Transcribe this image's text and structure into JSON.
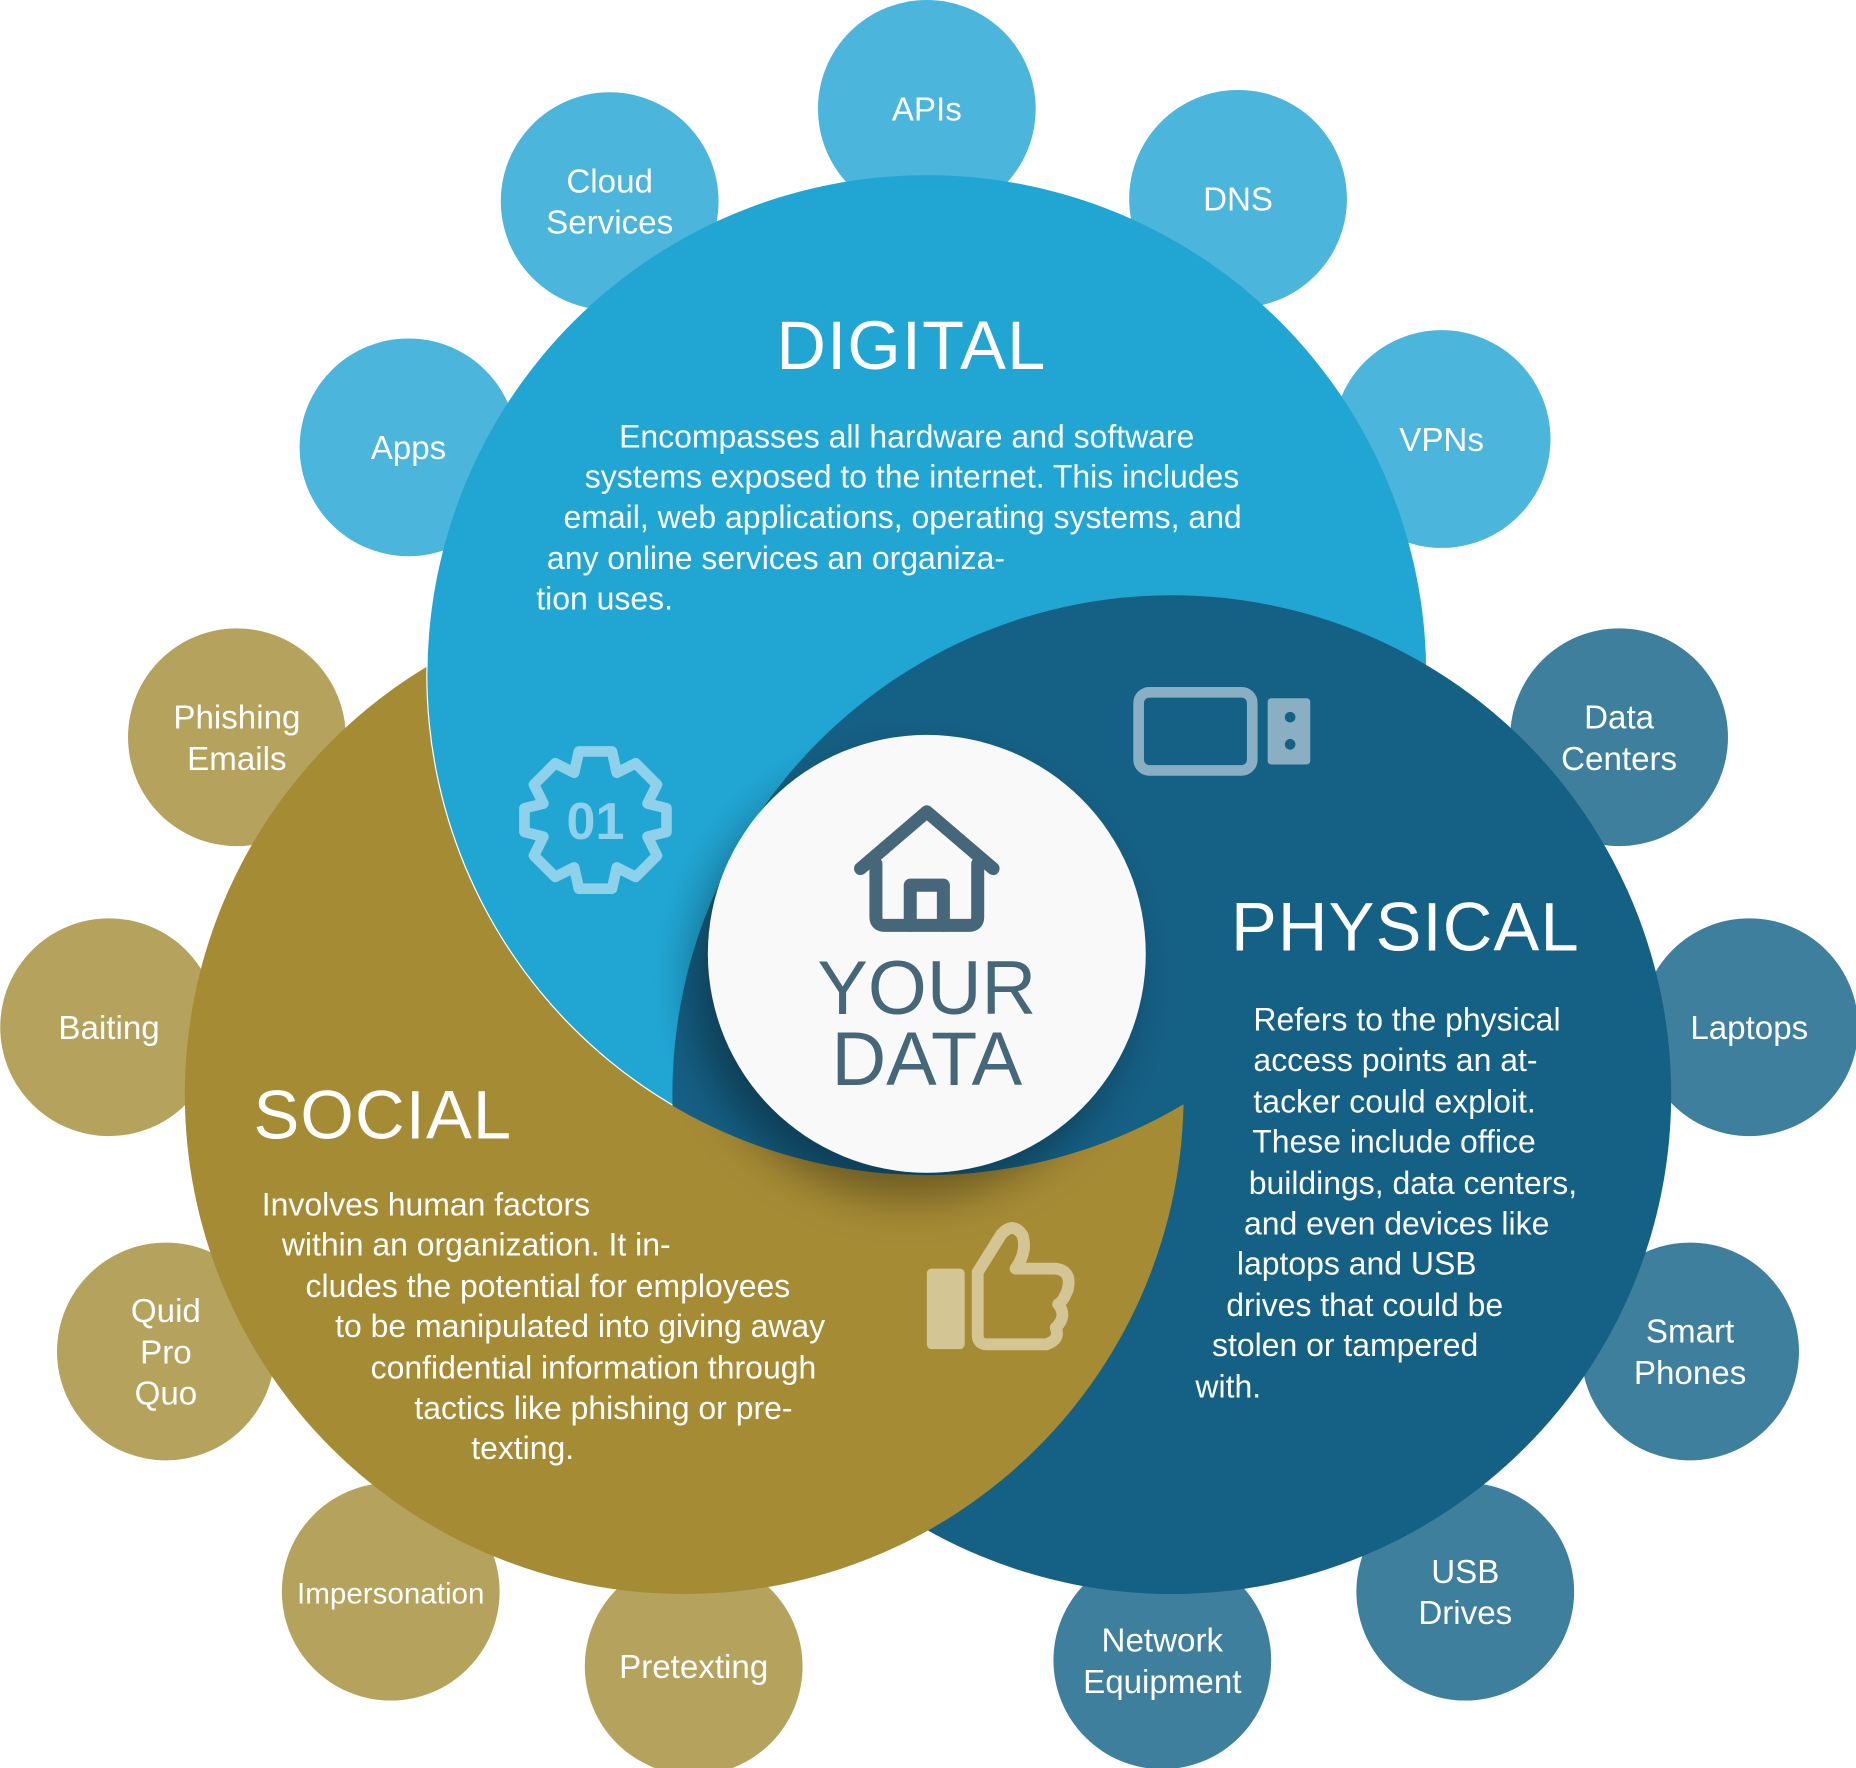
{
  "colors": {
    "digital": "#21a6d4",
    "digital_small": "#4bb5dc",
    "physical": "#156085",
    "physical_small": "#3f7f9e",
    "social": "#a68b35",
    "social_small": "#b5a25c",
    "center_text": "#46677a"
  },
  "center": {
    "line1": "YOUR",
    "line2": "DATA",
    "icon": "house-icon"
  },
  "digital": {
    "title": "DIGITAL",
    "icon": "gear-01-icon",
    "icon_text": "01",
    "lines": [
      "Encompasses all hardware and software",
      "systems exposed to the internet. This includes",
      "email, web applications, operating systems, and",
      "any online services an organiza-",
      "tion uses."
    ],
    "items": [
      [
        "APIs"
      ],
      [
        "DNS"
      ],
      [
        "VPNs"
      ],
      [
        "Cloud",
        "Services"
      ],
      [
        "Apps"
      ]
    ]
  },
  "physical": {
    "title": "PHYSICAL",
    "icon": "tablet-usb-icon",
    "lines": [
      "Refers to the physical",
      "access points an at-",
      "tacker could exploit.",
      "These include office",
      "buildings, data centers,",
      "and even devices like",
      "laptops and USB",
      "drives that could be",
      "stolen or tampered",
      "with."
    ],
    "items": [
      [
        "Data",
        "Centers"
      ],
      [
        "Laptops"
      ],
      [
        "Smart",
        "Phones"
      ],
      [
        "USB",
        "Drives"
      ],
      [
        "Network",
        "Equipment"
      ]
    ]
  },
  "social": {
    "title": "SOCIAL",
    "icon": "thumbs-up-icon",
    "lines": [
      "Involves human factors",
      "within an organization. It in-",
      "cludes the potential for employees",
      "to be manipulated into giving away",
      "confidential information through",
      "tactics like phishing or pre-",
      "texting."
    ],
    "items": [
      [
        "Phishing",
        "Emails"
      ],
      [
        "Baiting"
      ],
      [
        "Quid",
        "Pro",
        "Quo"
      ],
      [
        "Impersonation"
      ],
      [
        "Pretexting"
      ]
    ]
  }
}
